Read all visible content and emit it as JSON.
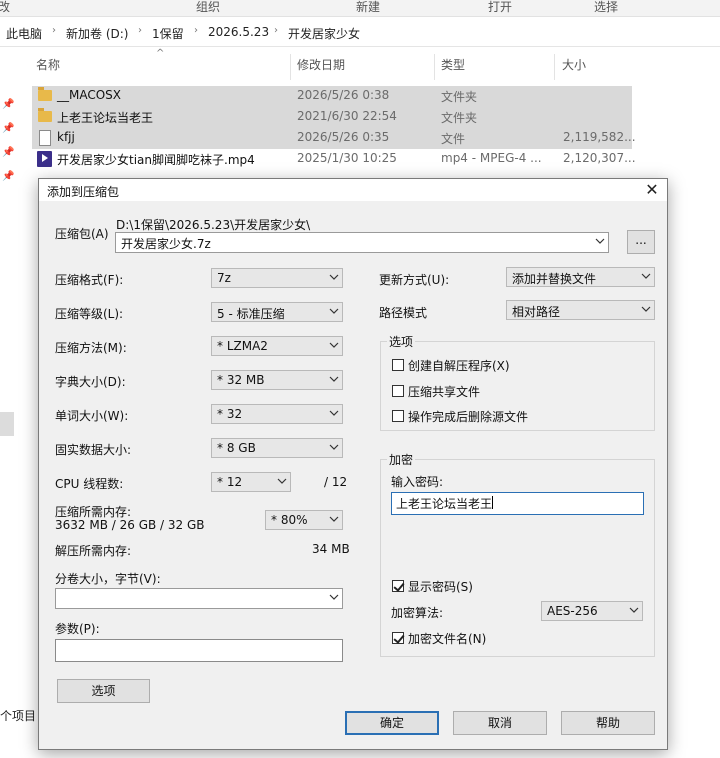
{
  "explorer": {
    "ribbon_groups": [
      "改",
      "组织",
      "新建",
      "打开",
      "选择"
    ],
    "breadcrumb": [
      "此电脑",
      "新加卷 (D:)",
      "1保留",
      "2026.5.23",
      "开发居家少女"
    ],
    "columns": {
      "name": "名称",
      "modified": "修改日期",
      "type": "类型",
      "size": "大小"
    },
    "files": [
      {
        "name": "__MACOSX",
        "modified": "2026/5/26 0:38",
        "type": "文件夹",
        "size": "",
        "icon": "folder-icon",
        "selected": true
      },
      {
        "name": "上老王论坛当老王",
        "modified": "2021/6/30 22:54",
        "type": "文件夹",
        "size": "",
        "icon": "folder-icon",
        "selected": true
      },
      {
        "name": "kfjj",
        "modified": "2026/5/26 0:35",
        "type": "文件",
        "size": "2,119,582...",
        "icon": "file-icon",
        "selected": true
      },
      {
        "name": "开发居家少女tian脚闻脚吃袜子.mp4",
        "modified": "2025/1/30 10:25",
        "type": "mp4 - MPEG-4 ...",
        "size": "2,120,307...",
        "icon": "video-file-icon",
        "selected": false
      }
    ],
    "status_items": "个项目"
  },
  "dialog": {
    "title": "添加到压缩包",
    "archive_label": "压缩包(A)",
    "archive_path": "D:\\1保留\\2026.5.23\\开发居家少女\\",
    "archive_name": "开发居家少女.7z",
    "browse_label": "...",
    "format_label": "压缩格式(F):",
    "format_value": "7z",
    "level_label": "压缩等级(L):",
    "level_value": "5 - 标准压缩",
    "method_label": "压缩方法(M):",
    "method_value": "* LZMA2",
    "dict_label": "字典大小(D):",
    "dict_value": "* 32 MB",
    "word_label": "单词大小(W):",
    "word_value": "* 32",
    "solid_label": "固实数据大小:",
    "solid_value": "* 8 GB",
    "cpu_label": "CPU 线程数:",
    "cpu_value": "* 12",
    "cpu_total": "/ 12",
    "mem_label": "压缩所需内存:",
    "mem_detail": "3632 MB / 26 GB / 32 GB",
    "mem_value": "* 80%",
    "decomp_label": "解压所需内存:",
    "decomp_value": "34 MB",
    "split_label": "分卷大小，字节(V):",
    "split_value": "",
    "params_label": "参数(P):",
    "params_value": "",
    "options_button": "选项",
    "update_label": "更新方式(U):",
    "update_value": "添加并替换文件",
    "pathmode_label": "路径模式",
    "pathmode_value": "相对路径",
    "options_group": "选项",
    "opt_sfx": "创建自解压程序(X)",
    "opt_shared": "压缩共享文件",
    "opt_delete": "操作完成后删除源文件",
    "encrypt_group": "加密",
    "password_label": "输入密码:",
    "password_value": "上老王论坛当老王",
    "show_password": "显示密码(S)",
    "enc_method_label": "加密算法:",
    "enc_method_value": "AES-256",
    "enc_names": "加密文件名(N)",
    "ok": "确定",
    "cancel": "取消",
    "help": "帮助"
  },
  "colors": {
    "focus_border": "#2a6fb4",
    "selection": "#d9d9d9",
    "folder": "#e8b94a"
  }
}
